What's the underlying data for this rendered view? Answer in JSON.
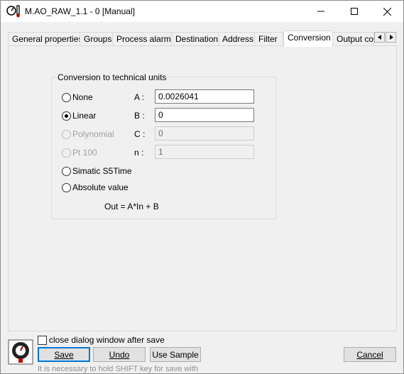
{
  "window": {
    "title": "M.AO_RAW_1.1 - 0 [Manual]"
  },
  "tabs": [
    {
      "label": "General properties"
    },
    {
      "label": "Groups"
    },
    {
      "label": "Process alarms"
    },
    {
      "label": "Destination"
    },
    {
      "label": "Address"
    },
    {
      "label": "Filter"
    },
    {
      "label": "Conversion"
    },
    {
      "label": "Output con"
    }
  ],
  "active_tab": "Conversion",
  "conversion": {
    "group_title": "Conversion to technical units",
    "options": [
      {
        "label": "None",
        "selected": false,
        "enabled": true
      },
      {
        "label": "Linear",
        "selected": true,
        "enabled": true
      },
      {
        "label": "Polynomial",
        "selected": false,
        "enabled": false
      },
      {
        "label": "Pt 100",
        "selected": false,
        "enabled": false
      },
      {
        "label": "Simatic S5Time",
        "selected": false,
        "enabled": true
      },
      {
        "label": "Absolute value",
        "selected": false,
        "enabled": true
      }
    ],
    "params": [
      {
        "label": "A :",
        "value": "0.0026041",
        "enabled": true
      },
      {
        "label": "B :",
        "value": "0",
        "enabled": true
      },
      {
        "label": "C :",
        "value": "0",
        "enabled": false
      },
      {
        "label": "n :",
        "value": "1",
        "enabled": false
      }
    ],
    "formula": "Out = A*In + B"
  },
  "footer": {
    "close_after_save_label": "close dialog window after save",
    "close_after_save_checked": false,
    "save_label": "Save",
    "undo_label": "Undo",
    "use_sample_label": "Use Sample",
    "cancel_label": "Cancel",
    "hint": "It is necessary to hold SHIFT key for save with"
  },
  "colors": {
    "accent": "#0078d7"
  },
  "icons": {
    "app": "thermometer-gauge-icon",
    "minimize": "minimize-icon",
    "maximize": "maximize-icon",
    "close": "close-icon",
    "footer": "sensor-icon"
  }
}
